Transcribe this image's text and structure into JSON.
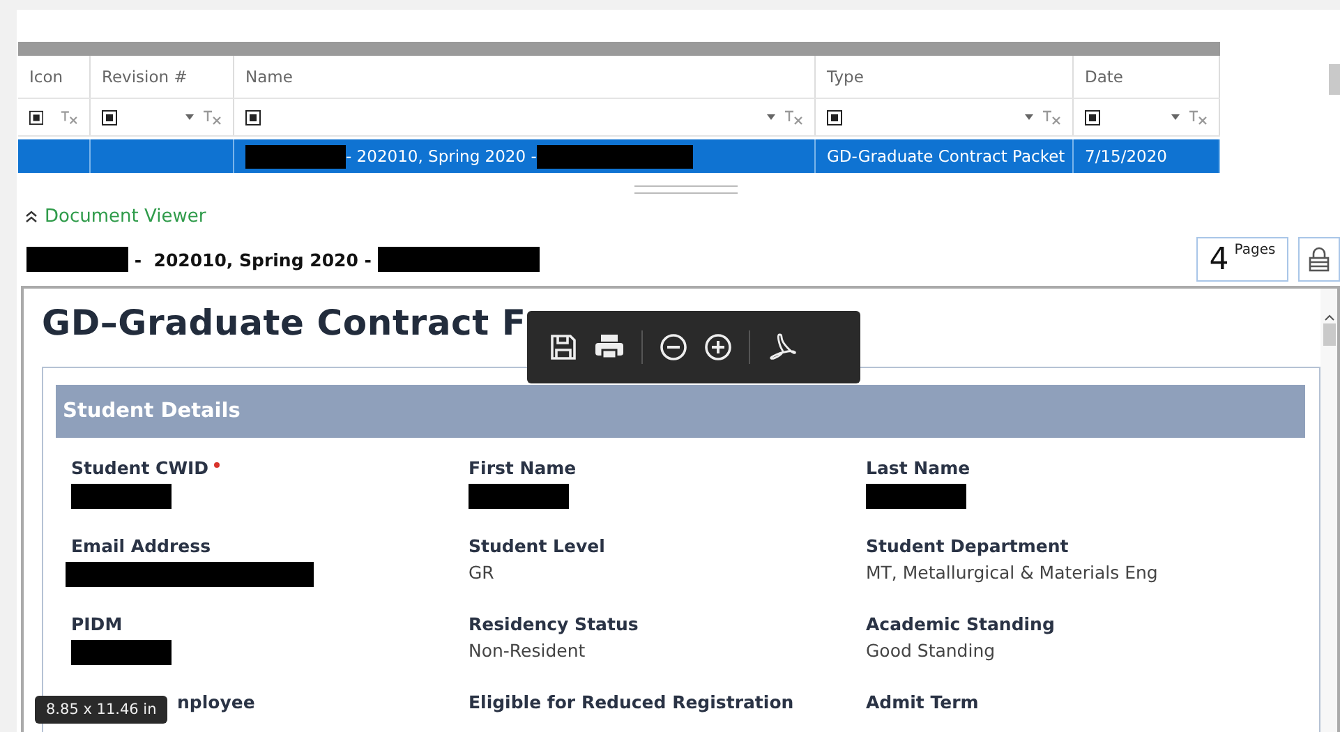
{
  "grid": {
    "columns": [
      {
        "label": "Icon",
        "filter_dropdown": false
      },
      {
        "label": "Revision #",
        "filter_dropdown": true
      },
      {
        "label": "Name",
        "filter_dropdown": true
      },
      {
        "label": "Type",
        "filter_dropdown": true
      },
      {
        "label": "Date",
        "filter_dropdown": true
      }
    ],
    "rows": [
      {
        "selected": true,
        "cells": [
          {},
          {},
          {
            "segments": [
              {
                "kind": "redacted"
              },
              {
                "kind": "text",
                "text": " - 202010, Spring 2020 - "
              },
              {
                "kind": "redacted"
              }
            ]
          },
          {
            "segments": [
              {
                "kind": "text",
                "text": "GD-Graduate Contract Packet"
              }
            ]
          },
          {
            "segments": [
              {
                "kind": "text",
                "text": "7/15/2020"
              }
            ]
          }
        ]
      }
    ]
  },
  "viewer": {
    "label": "Document Viewer",
    "expanded": true,
    "doc_title": [
      {
        "kind": "redacted"
      },
      {
        "kind": "text",
        "text": " -  202010, Spring 2020 - "
      },
      {
        "kind": "redacted"
      }
    ],
    "pages": {
      "count": "4",
      "label": "Pages"
    }
  },
  "document": {
    "title": "GD–Graduate Contract F",
    "section": "Student Details",
    "fields": [
      {
        "label": "Student CWID",
        "required": true,
        "value": {
          "kind": "redacted"
        }
      },
      {
        "label": "First Name",
        "value": {
          "kind": "redacted"
        }
      },
      {
        "label": "Last Name",
        "value": {
          "kind": "redacted"
        }
      },
      {
        "label": "Email Address",
        "value": {
          "kind": "redacted"
        }
      },
      {
        "label": "Student Level",
        "value": {
          "kind": "text",
          "text": "GR"
        }
      },
      {
        "label": "Student Department",
        "value": {
          "kind": "text",
          "text": "MT, Metallurgical & Materials Eng"
        }
      },
      {
        "label": "PIDM",
        "value": {
          "kind": "redacted"
        }
      },
      {
        "label": "Residency Status",
        "value": {
          "kind": "text",
          "text": "Non-Resident"
        }
      },
      {
        "label": "Academic Standing",
        "value": {
          "kind": "text",
          "text": "Good Standing"
        }
      },
      {
        "label": "nployee"
      },
      {
        "label": "Eligible for Reduced Registration"
      },
      {
        "label": "Admit Term"
      }
    ]
  },
  "size_tooltip": "8.85 x 11.46 in"
}
